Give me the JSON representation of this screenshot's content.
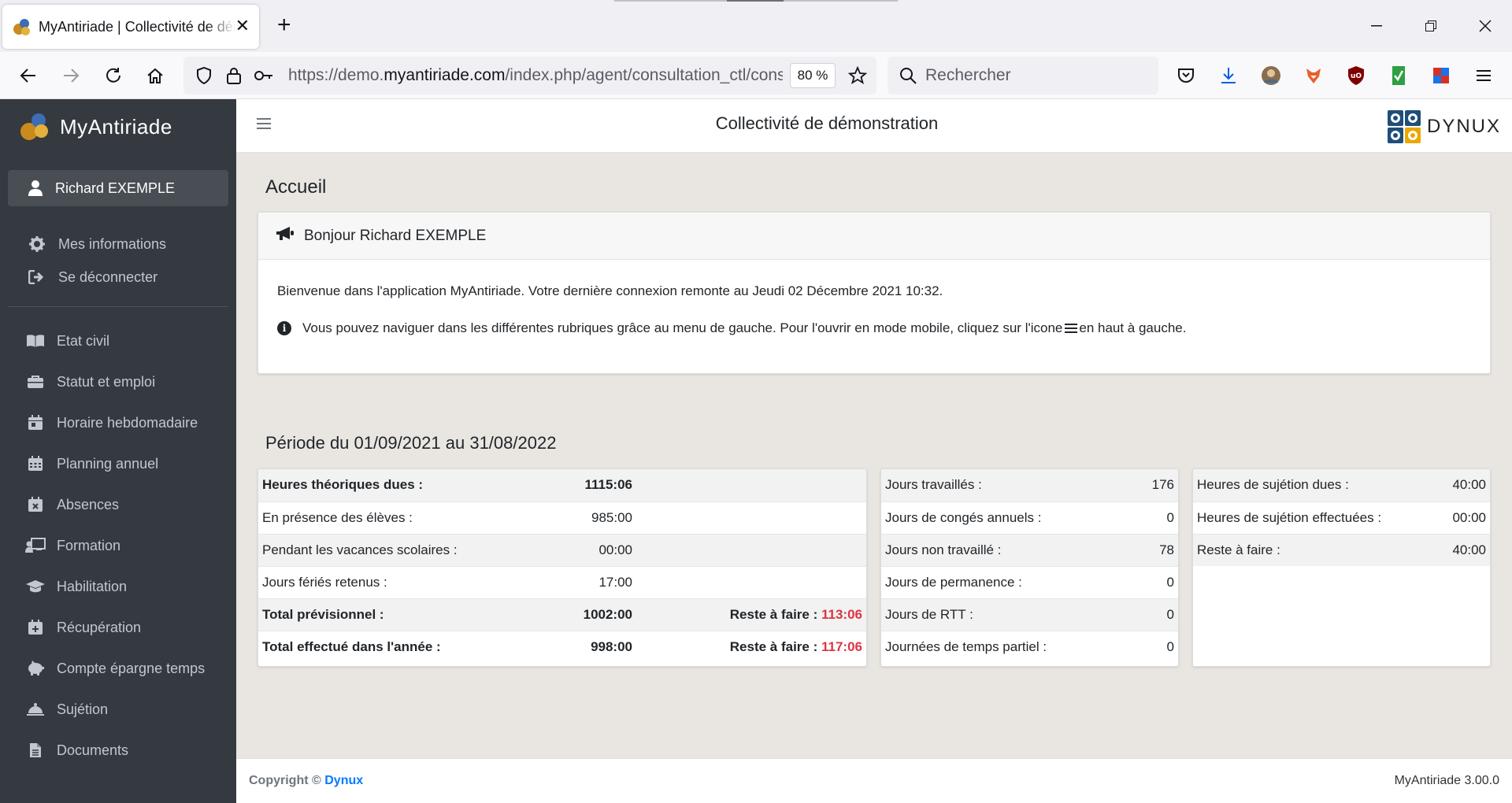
{
  "browser": {
    "tab_title": "MyAntiriade | Collectivité de démonstration",
    "url_prefix": "https://demo.",
    "url_domain": "myantiriade.com",
    "url_path": "/index.php/agent/consultation_ctl/consultation",
    "zoom": "80 %",
    "search_placeholder": "Rechercher"
  },
  "sidebar": {
    "brand": "MyAntiriade",
    "user": "Richard EXEMPLE",
    "account_items": [
      {
        "label": "Mes informations",
        "icon": "gear-icon"
      },
      {
        "label": "Se déconnecter",
        "icon": "sign-out-icon"
      }
    ],
    "menu_items": [
      {
        "label": "Etat civil",
        "icon": "book-icon"
      },
      {
        "label": "Statut et emploi",
        "icon": "briefcase-icon"
      },
      {
        "label": "Horaire hebdomadaire",
        "icon": "calendar-day-icon"
      },
      {
        "label": "Planning annuel",
        "icon": "calendar-icon"
      },
      {
        "label": "Absences",
        "icon": "calendar-times-icon"
      },
      {
        "label": "Formation",
        "icon": "chalkboard-teacher-icon"
      },
      {
        "label": "Habilitation",
        "icon": "graduation-cap-icon"
      },
      {
        "label": "Récupération",
        "icon": "calendar-plus-icon"
      },
      {
        "label": "Compte épargne temps",
        "icon": "piggy-bank-icon"
      },
      {
        "label": "Sujétion",
        "icon": "bell-icon"
      },
      {
        "label": "Documents",
        "icon": "file-icon"
      }
    ]
  },
  "header": {
    "title": "Collectivité de démonstration",
    "partner": "DYNUX"
  },
  "main": {
    "page_title": "Accueil",
    "welcome": {
      "heading": "Bonjour Richard EXEMPLE",
      "message": "Bienvenue dans l'application MyAntiriade. Votre dernière connexion remonte au Jeudi 02 Décembre 2021 10:32.",
      "hint_before": "Vous pouvez naviguer dans les différentes rubriques grâce au menu de gauche. Pour l'ouvrir en mode mobile, cliquez sur l'icone",
      "hint_after": "en haut à gauche."
    },
    "periode": "Période du 01/09/2021 au 31/08/2022",
    "hours": {
      "rows": [
        {
          "label": "Heures théoriques dues :",
          "value": "1115:06",
          "bold": true
        },
        {
          "label": "En présence des élèves :",
          "value": "985:00"
        },
        {
          "label": "Pendant les vacances scolaires :",
          "value": "00:00"
        },
        {
          "label": "Jours fériés retenus :",
          "value": "17:00"
        }
      ],
      "totals": [
        {
          "label": "Total prévisionnel :",
          "value": "1002:00",
          "rest_label": "Reste à faire :",
          "rest_value": "113:06"
        },
        {
          "label": "Total effectué dans l'année :",
          "value": "998:00",
          "rest_label": "Reste à faire :",
          "rest_value": "117:06"
        }
      ]
    },
    "days": [
      {
        "label": "Jours travaillés :",
        "value": "176"
      },
      {
        "label": "Jours de congés annuels :",
        "value": "0"
      },
      {
        "label": "Jours non travaillé :",
        "value": "78"
      },
      {
        "label": "Jours de permanence :",
        "value": "0"
      },
      {
        "label": "Jours de RTT :",
        "value": "0"
      },
      {
        "label": "Journées de temps partiel :",
        "value": "0"
      }
    ],
    "sujetion": [
      {
        "label": "Heures de sujétion dues :",
        "value": "40:00"
      },
      {
        "label": "Heures de sujétion effectuées :",
        "value": "00:00"
      },
      {
        "label": "Reste à faire :",
        "value": "40:00"
      }
    ]
  },
  "footer": {
    "copyright": "Copyright ©",
    "company": "Dynux",
    "version": "MyAntiriade 3.00.0"
  },
  "colors": {
    "sidebar": "#343a40",
    "accent": "#007bff",
    "danger": "#dc3545"
  }
}
